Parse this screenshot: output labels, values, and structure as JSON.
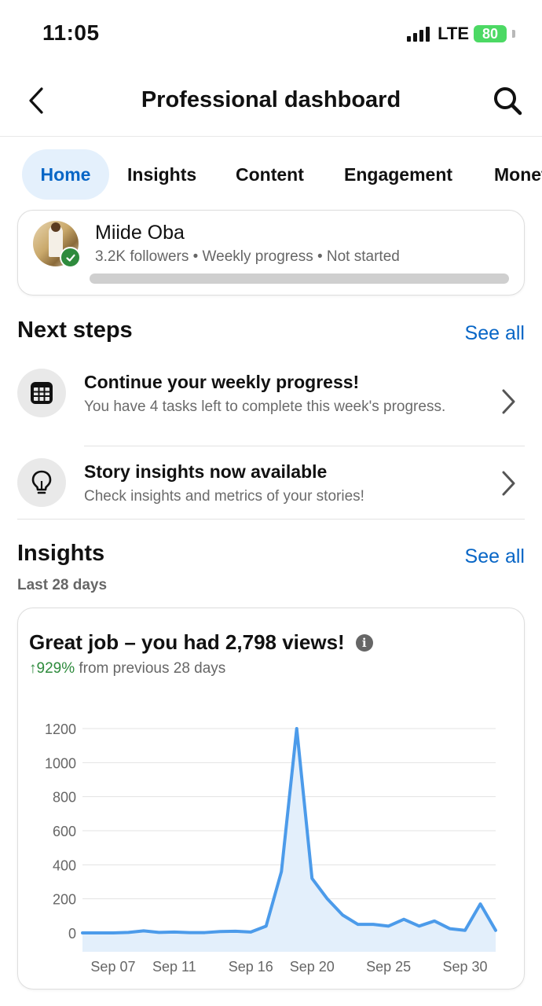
{
  "status_bar": {
    "time": "11:05",
    "network": "LTE",
    "battery": "80"
  },
  "nav": {
    "title": "Professional dashboard",
    "back_icon": "chevron-left-icon",
    "search_icon": "search-icon"
  },
  "tabs": [
    {
      "label": "Home",
      "active": true
    },
    {
      "label": "Insights",
      "active": false
    },
    {
      "label": "Content",
      "active": false
    },
    {
      "label": "Engagement",
      "active": false
    },
    {
      "label": "Monet",
      "active": false
    }
  ],
  "profile": {
    "name": "Miide Oba",
    "subtitle": "3.2K followers • Weekly progress • Not started",
    "progress": 0
  },
  "next_steps": {
    "title": "Next steps",
    "see_all": "See all",
    "items": [
      {
        "title": "Continue your weekly progress!",
        "description": "You have 4 tasks left to complete this week's progress.",
        "icon": "calendar-grid-icon"
      },
      {
        "title": "Story insights now available",
        "description": "Check insights and metrics of your stories!",
        "icon": "lightbulb-icon"
      }
    ]
  },
  "insights": {
    "title": "Insights",
    "see_all": "See all",
    "period": "Last 28 days",
    "card": {
      "headline": "Great job – you had 2,798 views!",
      "change_value": "↑929%",
      "change_text": " from previous 28 days"
    }
  },
  "colors": {
    "accent": "#0866c6",
    "active_tab_bg": "#e4f0fc",
    "positive": "#2e8b3d",
    "line": "#4c9bea",
    "area": "#e3effb"
  },
  "chart_data": {
    "type": "area",
    "title": "",
    "xlabel": "",
    "ylabel": "",
    "ylim": [
      0,
      1200
    ],
    "yticks": [
      "1200",
      "1000",
      "800",
      "600",
      "400",
      "200",
      "0"
    ],
    "xticks": [
      "Sep 07",
      "Sep 11",
      "Sep 16",
      "Sep 20",
      "Sep 25",
      "Sep 30"
    ],
    "x": [
      "Sep 05",
      "Sep 06",
      "Sep 07",
      "Sep 08",
      "Sep 09",
      "Sep 10",
      "Sep 11",
      "Sep 12",
      "Sep 13",
      "Sep 14",
      "Sep 15",
      "Sep 16",
      "Sep 17",
      "Sep 18",
      "Sep 19",
      "Sep 20",
      "Sep 21",
      "Sep 22",
      "Sep 23",
      "Sep 24",
      "Sep 25",
      "Sep 26",
      "Sep 27",
      "Sep 28",
      "Sep 29",
      "Sep 30",
      "Oct 01",
      "Oct 02"
    ],
    "series": [
      {
        "values": [
          0,
          0,
          0,
          3,
          12,
          3,
          5,
          2,
          2,
          8,
          10,
          5,
          40,
          360,
          1200,
          320,
          200,
          105,
          50,
          50,
          40,
          80,
          40,
          70,
          25,
          15,
          170,
          15
        ]
      }
    ],
    "grid": true
  }
}
